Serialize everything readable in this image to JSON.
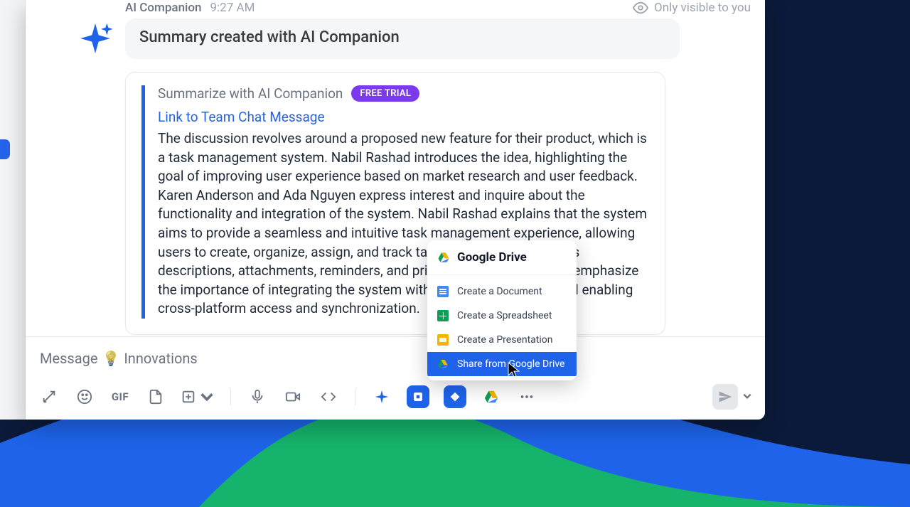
{
  "message": {
    "sender": "AI Companion",
    "time": "9:27 AM",
    "visibility": "Only visible to you"
  },
  "summary": {
    "title": "Summary created with AI Companion",
    "heading": "Summarize with AI Companion",
    "badge": "FREE TRIAL",
    "link_text": "Link to Team Chat Message",
    "body": "The discussion revolves around a proposed new feature for their product, which is a task management system. Nabil Rashad introduces the idea, highlighting the goal of improving user experience based on market research and user feedback. Karen Anderson and Ada Nguyen express interest and inquire about the functionality and integration of the system. Nabil Rashad explains that the system aims to provide a seamless and intuitive task management experience, allowing users to create, organize, assign, and track tasks with features such as descriptions, attachments, reminders, and priority settings. They also emphasize the importance of integrating the system with the existing product and enabling cross-platform access and synchronization."
  },
  "compose": {
    "prefix": "Message",
    "channel": "Innovations"
  },
  "toolbar": {
    "gif_label": "GIF"
  },
  "drive_popup": {
    "title": "Google Drive",
    "items": [
      {
        "label": "Create a Document"
      },
      {
        "label": "Create a Spreadsheet"
      },
      {
        "label": "Create a Presentation"
      },
      {
        "label": "Share from Google Drive"
      }
    ]
  }
}
